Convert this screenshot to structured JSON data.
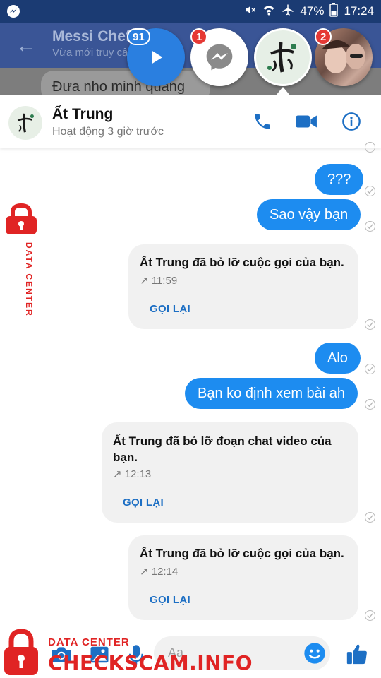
{
  "status_bar": {
    "battery": "47%",
    "time": "17:24"
  },
  "background_chat": {
    "title": "Messi Chef",
    "subtitle": "Vừa mới truy cậ",
    "bubble_text": "Đưa nho minh quang"
  },
  "chat_heads": [
    {
      "icon": "play-icon",
      "badge": "91"
    },
    {
      "icon": "messenger-icon",
      "badge": "1"
    },
    {
      "icon": "calligraphy-avatar",
      "badge": ""
    },
    {
      "icon": "photo-avatar",
      "badge": "2"
    }
  ],
  "header": {
    "name": "Ất Trung",
    "status": "Hoạt động 3 giờ trước",
    "icons": [
      "phone-icon",
      "video-icon",
      "info-icon"
    ],
    "accent": "#1d6fc4"
  },
  "messages": {
    "out1": "???",
    "out2": "Sao vậy bạn",
    "call1": {
      "text": "Ất Trung đã bỏ lỡ cuộc gọi của bạn.",
      "time": "↗ 11:59",
      "action": "GỌI LẠI"
    },
    "out3": "Alo",
    "out4": "Bạn ko định xem bài ah",
    "call2": {
      "text_line1": "Ất Trung đã bỏ lỡ đoạn chat video của",
      "text_line2": "bạn.",
      "time": "↗ 12:13",
      "action": "GỌI LẠI"
    },
    "call3": {
      "text": "Ất Trung đã bỏ lỡ cuộc gọi của bạn.",
      "time": "↗ 12:14",
      "action": "GỌI LẠI"
    }
  },
  "composer": {
    "placeholder": "Aa",
    "icons": [
      "camera-icon",
      "gallery-icon",
      "mic-icon",
      "emoji-icon",
      "like-icon"
    ]
  },
  "watermark": {
    "small": "DATA CENTER",
    "big": "CHECKSCAM.INFO"
  },
  "colors": {
    "bubble_out": "#1d8cf0",
    "bubble_in": "#f1f1f1",
    "watermark": "#e02424",
    "status_bar": "#1b3b73"
  }
}
